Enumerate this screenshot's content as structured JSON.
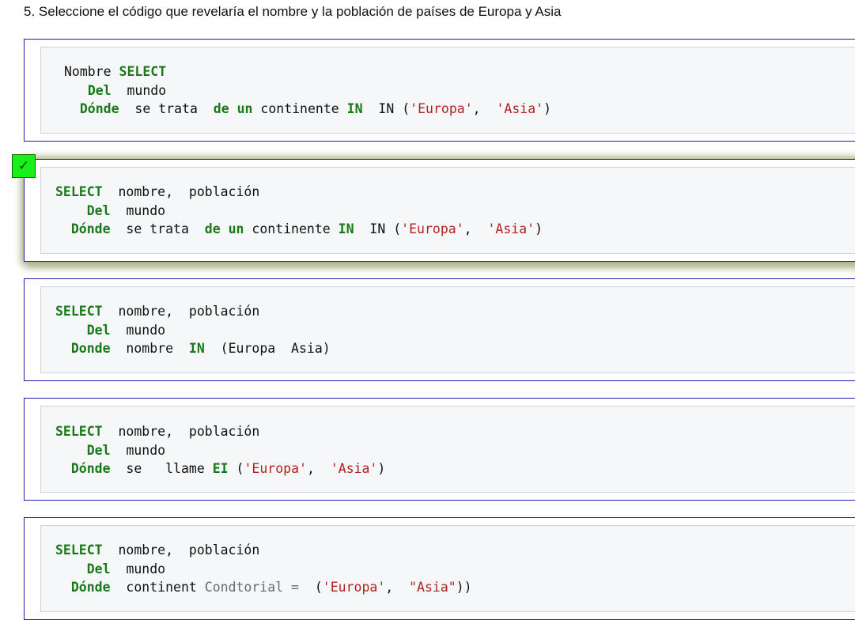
{
  "question": "5. Seleccione el código que revelaría el nombre y la población de países de Europa y Asia",
  "correct_mark": "✓",
  "options": [
    {
      "l1": {
        "a": "Nombre ",
        "kw": "SELECT"
      },
      "l2": {
        "kw": "Del",
        "t": "mundo"
      },
      "l3": {
        "kw1": "Dónde",
        "t1": "se trata",
        "kw2": "de un",
        "t2": "continente",
        "kw3": "IN",
        "t3": "IN (",
        "s1": "'Europa'",
        "t4": ",",
        "s2": "'Asia'",
        "t5": ")"
      }
    },
    {
      "l1": {
        "kw": "SELECT",
        "t": "nombre,  población"
      },
      "l2": {
        "kw": "Del",
        "t": "mundo"
      },
      "l3": {
        "kw1": "Dónde",
        "t1": "se trata",
        "kw2": "de un",
        "t2": "continente",
        "kw3": "IN",
        "t3": "IN (",
        "s1": "'Europa'",
        "t4": ",",
        "s2": "'Asia'",
        "t5": ")"
      }
    },
    {
      "l1": {
        "kw": "SELECT",
        "t": "nombre,  población"
      },
      "l2": {
        "kw": "Del",
        "t": "mundo"
      },
      "l3": {
        "kw1": "Donde",
        "t1": "nombre",
        "kw2": "IN",
        "t2": "(Europa  Asia)"
      }
    },
    {
      "l1": {
        "kw": "SELECT",
        "t": "nombre,  población"
      },
      "l2": {
        "kw": "Del",
        "t": "mundo"
      },
      "l3": {
        "kw1": "Dónde",
        "t1": "se",
        "t2": "llame",
        "kw2": "EI",
        "t3": "(",
        "s1": "'Europa'",
        "t4": ",",
        "s2": "'Asia'",
        "t5": ")"
      }
    },
    {
      "l1": {
        "kw": "SELECT",
        "t": "nombre,  población"
      },
      "l2": {
        "kw": "Del",
        "t": "mundo"
      },
      "l3": {
        "kw1": "Dónde",
        "t1": "continent",
        "c1": "Condtorial =",
        "t2": "(",
        "s1": "'Europa'",
        "t3": ",",
        "s2": "\"Asia\"",
        "t4": "))"
      }
    }
  ]
}
